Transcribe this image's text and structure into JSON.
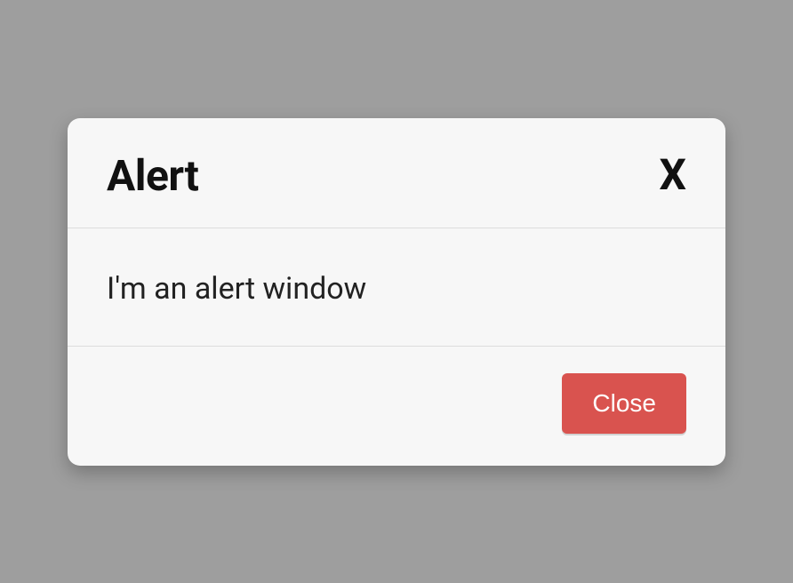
{
  "dialog": {
    "title": "Alert",
    "close_icon": "X",
    "message": "I'm an alert window",
    "close_button_label": "Close"
  },
  "colors": {
    "background": "#9e9e9e",
    "dialog_bg": "#f7f7f7",
    "button_bg": "#d9534f",
    "button_text": "#ffffff"
  }
}
